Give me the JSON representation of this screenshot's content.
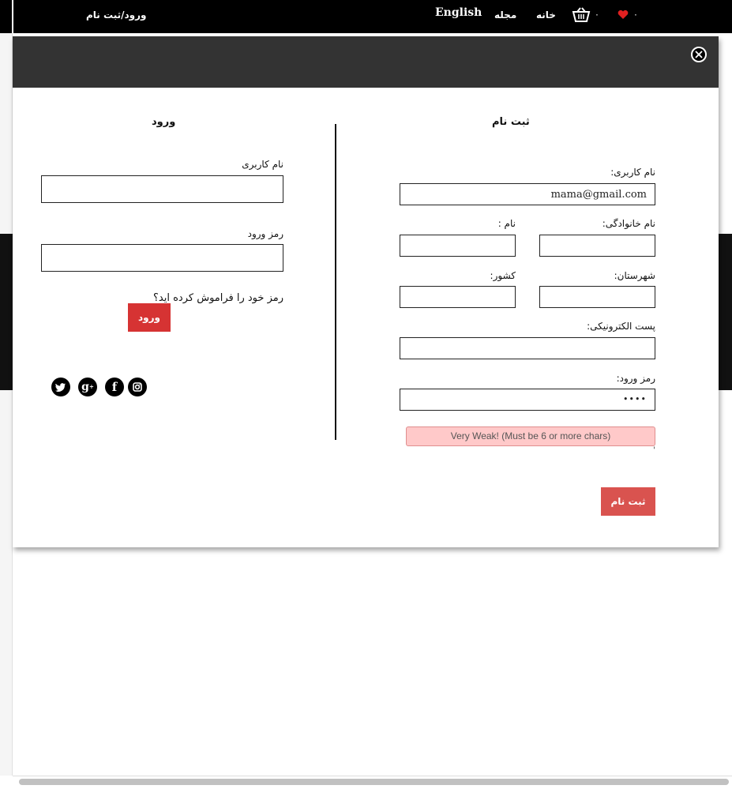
{
  "nav": {
    "login_register": "ورود/ثبت نام",
    "english": "English",
    "magazine": "مجله",
    "home": "خانه",
    "cart_count": "۰",
    "wishlist_count": "۰"
  },
  "modal": {
    "register": {
      "title": "ثبت نام",
      "username_label": "نام کاربری:",
      "username_value": "mama@gmail.com",
      "lastname_label": "نام خانوادگی:",
      "firstname_label": "نام :",
      "city_label": "شهرستان:",
      "country_label": "کشور:",
      "email_label": "پست الکترونیکی:",
      "password_label": "رمز ورود:",
      "password_value": "••••",
      "strength_text": "(Very Weak! (Must be 6 or more chars",
      "strength_tick": "'",
      "submit_label": "ثبت نام"
    },
    "login": {
      "title": "ورود",
      "username_label": "نام کاربری",
      "password_label": "رمز ورود",
      "forgot_label": "رمز خود را فراموش کرده اید؟",
      "submit_label": "ورود"
    },
    "social": {
      "twitter": "twitter-icon",
      "google": "google-plus-icon",
      "facebook": "facebook-icon",
      "instagram": "instagram-icon"
    }
  },
  "colors": {
    "topbar": "#000000",
    "modal_header": "#333333",
    "button_red": "#d63333",
    "register_button": "#d9534f",
    "weak_bg": "#ffc9c9",
    "heart": "#e02020"
  }
}
